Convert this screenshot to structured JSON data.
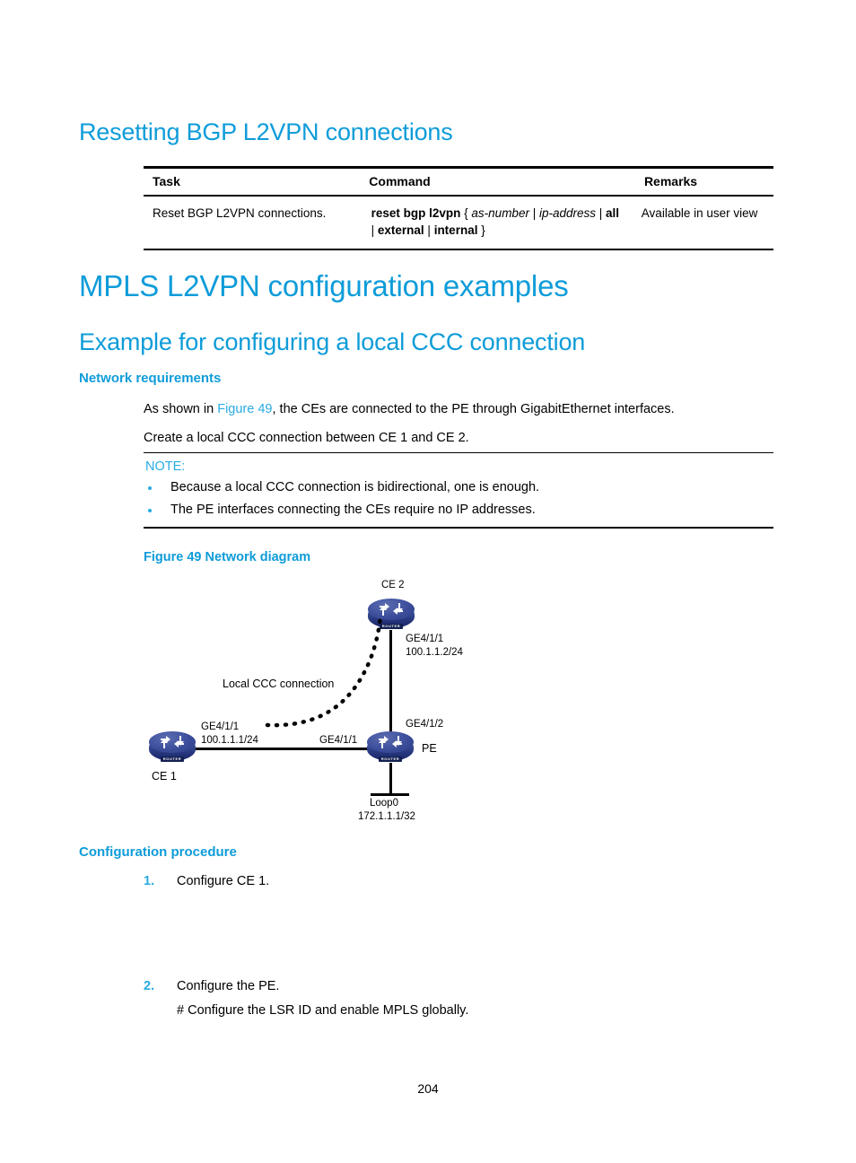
{
  "page": {
    "number": "204"
  },
  "section_reset": {
    "heading": "Resetting BGP L2VPN connections",
    "table": {
      "headers": [
        "Task",
        "Command",
        "Remarks"
      ],
      "rows": [
        {
          "task": "Reset BGP L2VPN connections.",
          "command_parts": [
            {
              "text": "reset bgp l2vpn",
              "style": "bold"
            },
            {
              "text": " { ",
              "style": "plain"
            },
            {
              "text": "as-number",
              "style": "italic"
            },
            {
              "text": " | ",
              "style": "plain"
            },
            {
              "text": "ip-address",
              "style": "italic"
            },
            {
              "text": " | ",
              "style": "plain"
            },
            {
              "text": "all",
              "style": "bold"
            },
            {
              "text": " | ",
              "style": "plain"
            },
            {
              "text": "external",
              "style": "bold"
            },
            {
              "text": " | ",
              "style": "plain"
            },
            {
              "text": "internal",
              "style": "bold"
            },
            {
              "text": " }",
              "style": "plain"
            }
          ],
          "command_plain": "reset bgp l2vpn { as-number | ip-address | all | external | internal }",
          "remarks": "Available in user view"
        }
      ]
    }
  },
  "section_examples": {
    "heading": "MPLS L2VPN configuration examples",
    "subheading": "Example for configuring a local CCC connection",
    "network_requirements": {
      "heading": "Network requirements",
      "paragraph_1_pre": "As shown in ",
      "paragraph_1_link": "Figure 49",
      "paragraph_1_post": ", the CEs are connected to the PE through GigabitEthernet interfaces.",
      "paragraph_2": "Create a local CCC connection between CE 1 and CE 2."
    },
    "note": {
      "title": "NOTE:",
      "items": [
        "Because a local CCC connection is bidirectional, one is enough.",
        "The PE interfaces connecting the CEs require no IP addresses."
      ]
    },
    "figure": {
      "caption": "Figure 49 Network diagram",
      "nodes": [
        {
          "id": "ce2",
          "label": "CE 2",
          "icon": "router-icon"
        },
        {
          "id": "ce1",
          "label": "CE 1",
          "icon": "router-icon"
        },
        {
          "id": "pe",
          "label": "PE",
          "icon": "router-icon"
        }
      ],
      "labels": {
        "ce2_iface_name": "GE4/1/1",
        "ce2_iface_addr": "100.1.1.2/24",
        "ce1_iface_name": "GE4/1/1",
        "ce1_iface_addr": "100.1.1.1/24",
        "pe_iface_left": "GE4/1/1",
        "pe_iface_up": "GE4/1/2",
        "loopback_name": "Loop0",
        "loopback_addr": "172.1.1.1/32",
        "ccc_annotation": "Local CCC connection",
        "router_plate": "ROUTER"
      }
    },
    "configuration_procedure": {
      "heading": "Configuration procedure",
      "steps": [
        {
          "number": "1.",
          "text": "Configure CE 1.",
          "sub": []
        },
        {
          "number": "2.",
          "text": "Configure the PE.",
          "sub": [
            "# Configure the LSR ID and enable MPLS globally."
          ]
        }
      ]
    }
  },
  "colors": {
    "heading_blue": "#0e9cd9",
    "link_blue": "#29abe2",
    "router_body": "#2c3b85",
    "rule_black": "#000000"
  }
}
